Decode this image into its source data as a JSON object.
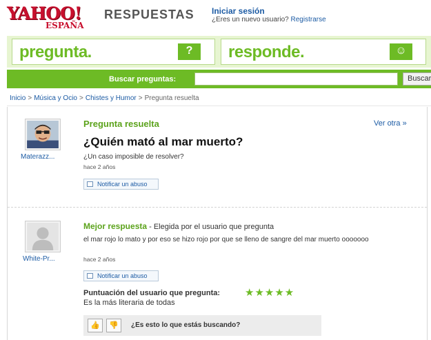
{
  "header": {
    "logo_yahoo": "YAHOO!",
    "logo_espana": "ESPAÑA",
    "brand": "RESPUESTAS",
    "sign_in": "Iniciar sesión",
    "new_user_question": "¿Eres un nuevo usuario?",
    "register": "Registrarse"
  },
  "banner": {
    "ask_label": "pregunta.",
    "answer_label": "responde."
  },
  "search": {
    "label": "Buscar preguntas:",
    "value": "",
    "button": "Buscar"
  },
  "breadcrumb": {
    "items": [
      "Inicio",
      "Música y Ocio",
      "Chistes y Humor"
    ],
    "current": "Pregunta resuelta",
    "separator": ">"
  },
  "question": {
    "status": "Pregunta resuelta",
    "see_other": "Ver otra »",
    "title": "¿Quién mató al mar muerto?",
    "detail": "¿Un caso imposible de resolver?",
    "time": "hace 2 años",
    "report": "Notificar un abuso",
    "user": "Materazz..."
  },
  "best_answer": {
    "heading": "Mejor respuesta",
    "chosen_by": " - Elegida por el usuario que pregunta",
    "text": "el mar rojo lo mato y por eso se hizo rojo por que se lleno de sangre del mar muerto ooooooo",
    "time": "hace 2 años",
    "report": "Notificar un abuso",
    "user": "White-Pr...",
    "rating_label": "Puntuación del usuario que pregunta:",
    "rating_stars": "★★★★★",
    "rating_value": 5,
    "rating_comment": "Es la más literaria de todas",
    "helpful_question": "¿Es esto lo que estás buscando?"
  },
  "colors": {
    "brand_green": "#6dbb25",
    "link_blue": "#1c5ba4",
    "yahoo_red": "#c8102e"
  }
}
